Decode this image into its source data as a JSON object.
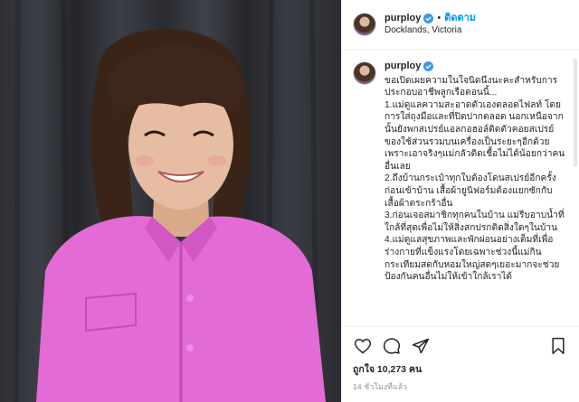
{
  "header": {
    "username": "purploy",
    "separator": "•",
    "follow_label": "ติดตาม",
    "location": "Docklands, Victoria"
  },
  "caption": {
    "username": "purploy",
    "text": "ขอเปิดเผยความในใจนิดนึงนะคะสำหรับการประกอบอาชีพลูกเรือตอนนี้...\n1.แม่ดูแลความสะอาดตัวเองตลอดไฟลท์ โดยการใส่ถุงมือและที่ปิดปากตลอด นอกเหนือจากนั้นยังพกสเปรย์แอลกอฮอล์ติดตัวคอยสเปรย์ของใช้ส่วนรวมบนเครื่องเป็นระยะๆอีกด้วย เพราะเอาจริงๆแม่กลัวติดเชื้อไม่ได้น้อยกว่าคนอื่นเลย\n2.ถึงบ้านกระเป๋าทุกใบต้องโดนสเปรย์อีกครั้งก่อนเข้าบ้าน เสื้อผ้ายูนิฟอร์มต้องแยกซักกับเสื้อผ้าตระกร้าอื่น\n3.ก่อนเจอสมาชิกทุกคนในบ้าน แม่รีบอาบน้ำที่ใกล้ที่สุดเพื่อไม่ให้สิ่งสกปรกติดสิ่งใดๆในบ้าน\n4.แม่ดูแลสุขภาพและพักผ่อนอย่างเต็มที่เพื่อร่างกายที่แข็งแรงโดยเฉพาะช่วงนี้แม่กินกระเทียมสดกับหอมใหญ่สดๆเยอะมากจะช่วยป้องกันคนอื่นไม่ให้เข้าใกล้เราได้"
  },
  "actions": {
    "likes_label": "ถูกใจ 10,273 คน",
    "timestamp": "14 ชั่วโมงที่แล้ว"
  },
  "icons": [
    "verified-badge-icon",
    "heart-icon",
    "comment-icon",
    "share-icon",
    "bookmark-icon"
  ],
  "colors": {
    "follow_blue": "#0095f6",
    "verified_blue": "#3897f0",
    "shirt_pink": "#e36bd6",
    "background_curtain": "#2e2f35"
  }
}
